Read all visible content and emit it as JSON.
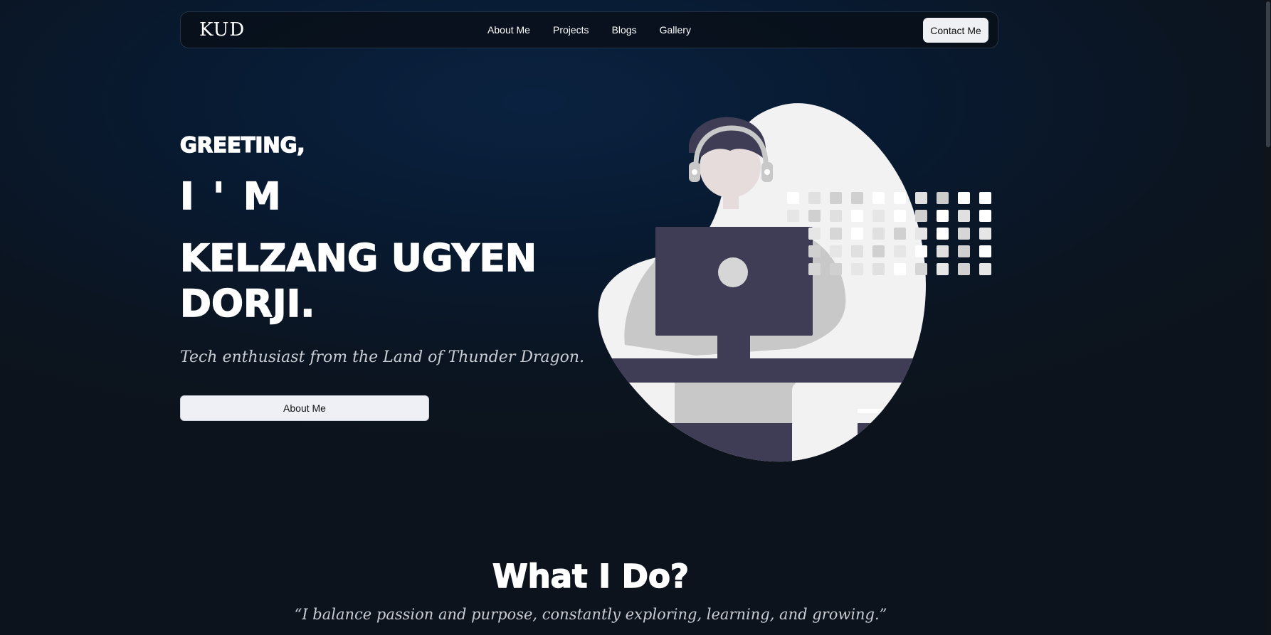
{
  "navbar": {
    "logo": "KUD",
    "links": [
      "About Me",
      "Projects",
      "Blogs",
      "Gallery"
    ],
    "contact_label": "Contact Me"
  },
  "hero": {
    "greeting": "GREETING,",
    "im": "I ' M",
    "name": "KELZANG UGYEN DORJI.",
    "tagline": "Tech enthusiast from the Land of Thunder Dragon.",
    "about_button": "About Me"
  },
  "section": {
    "title": "What I Do?",
    "quote": "“I balance passion and purpose, constantly exploring, learning, and growing.”"
  },
  "colors": {
    "accent": "#eef0f4",
    "background": "#081a31",
    "illustration_dark": "#3f3d56",
    "illustration_light": "#f2f2f2"
  }
}
